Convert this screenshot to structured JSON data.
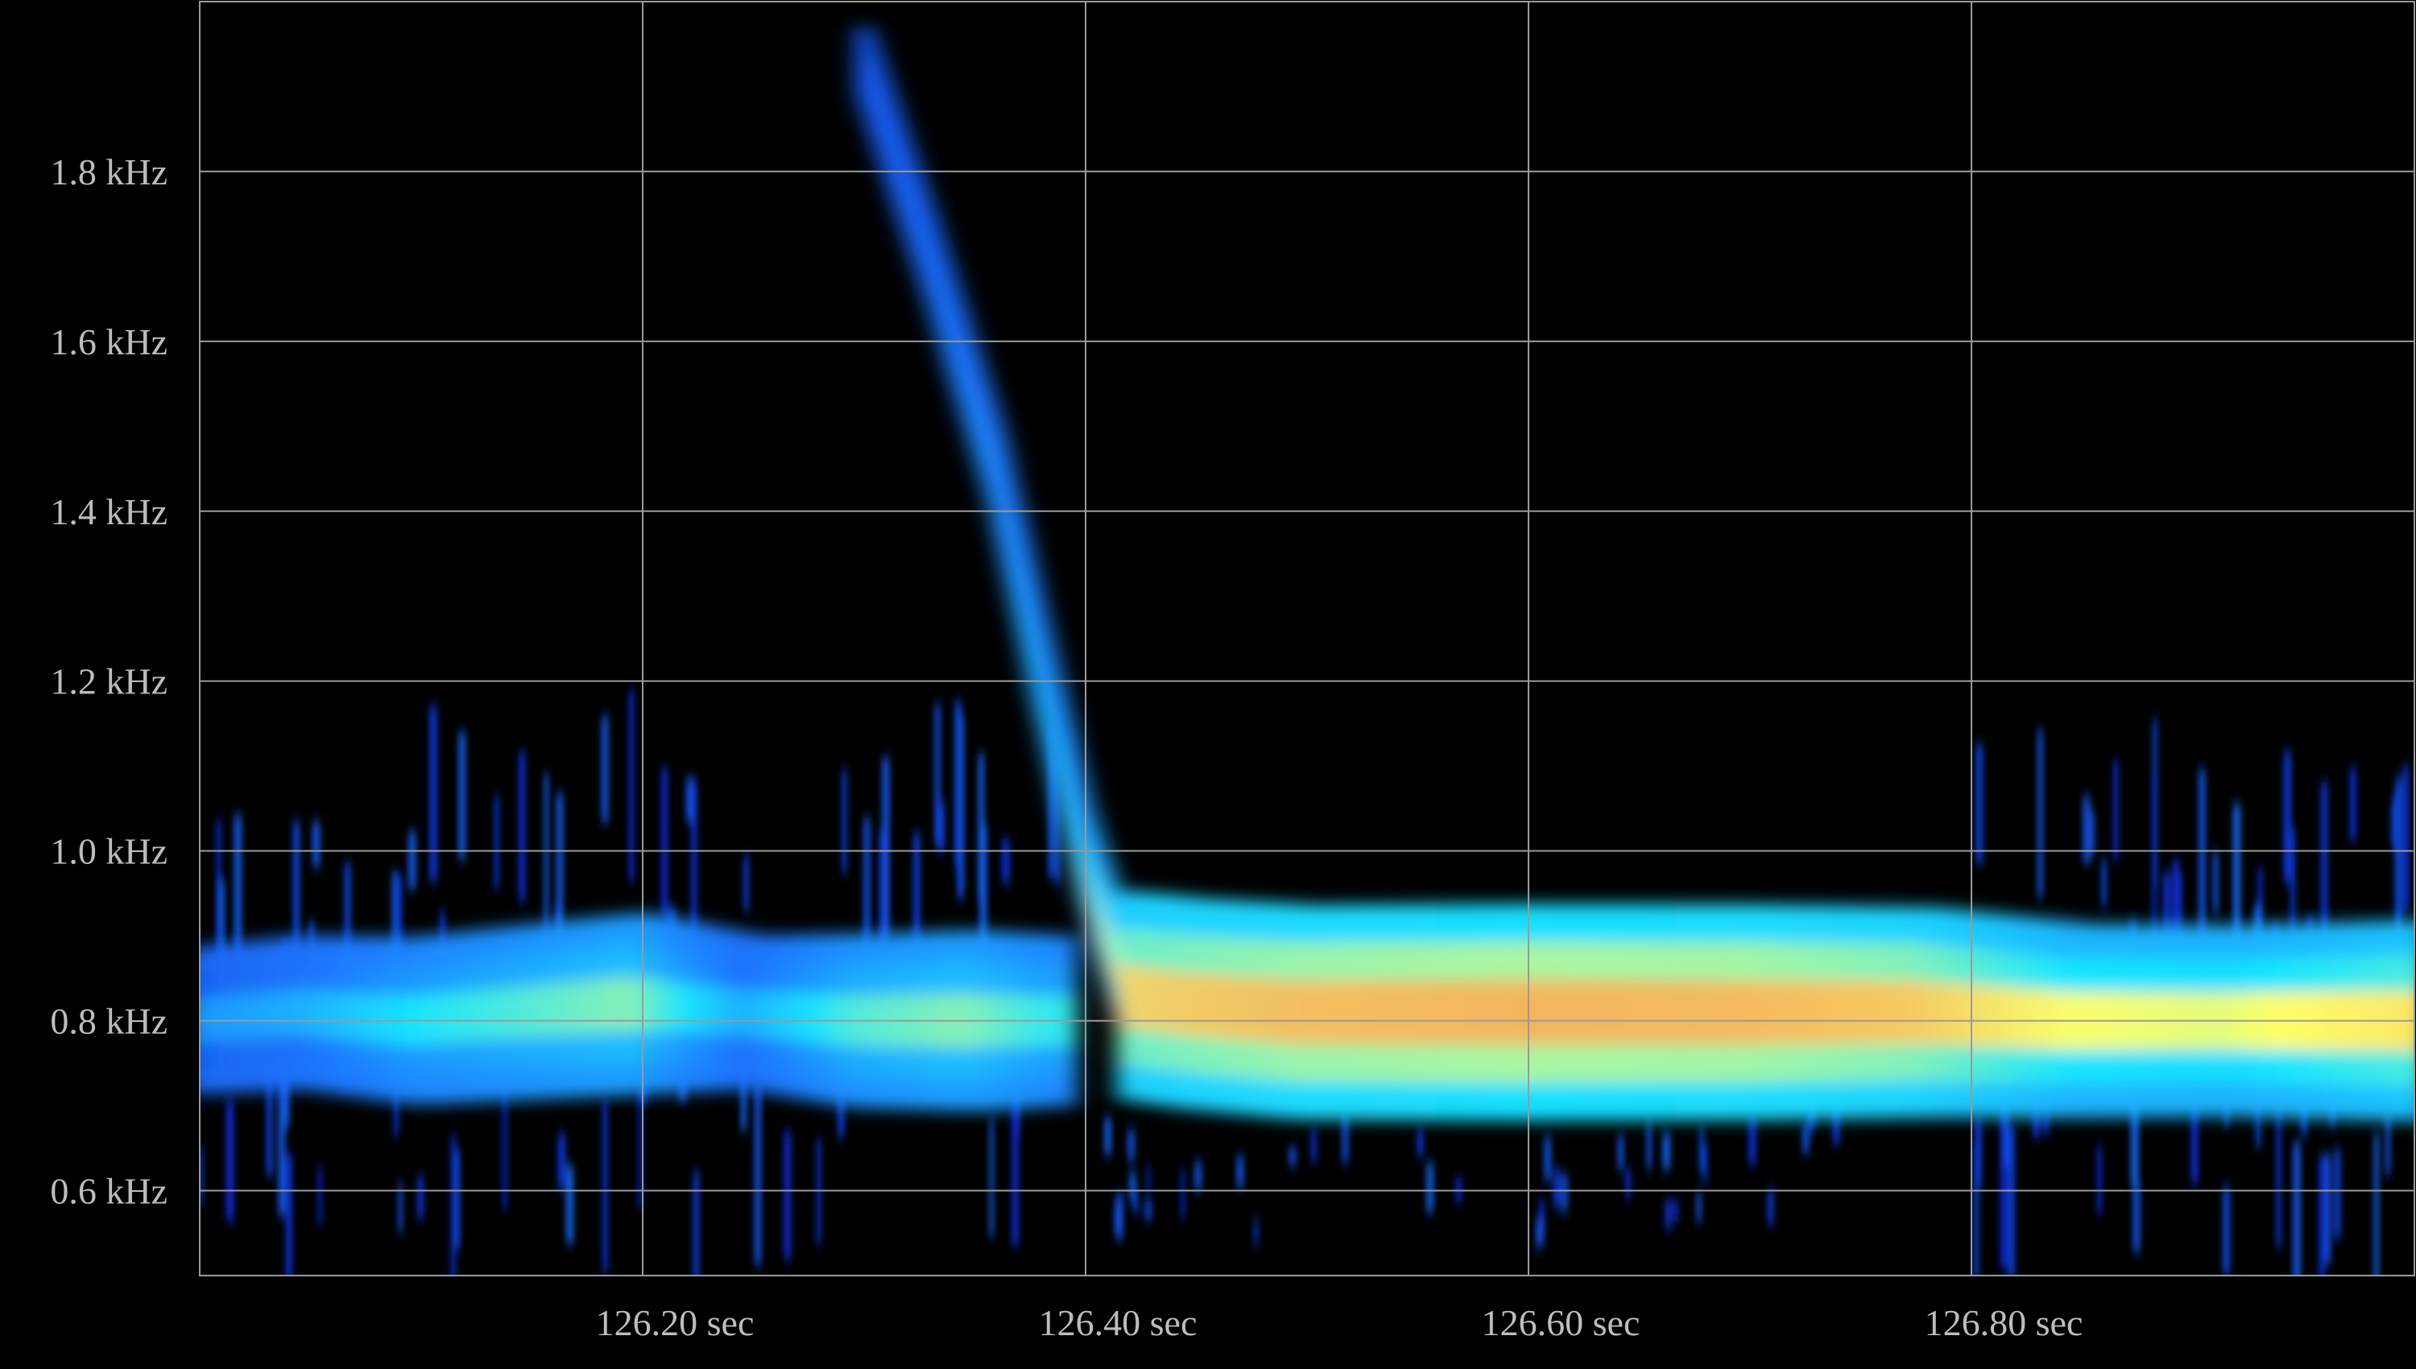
{
  "chart_data": {
    "type": "heatmap",
    "subtype": "spectrogram",
    "title": "",
    "xlabel": "",
    "ylabel": "",
    "xlim": [
      126.0,
      127.0
    ],
    "ylim": [
      0.5,
      2.0
    ],
    "x_ticks": [
      {
        "value": 126.2,
        "label": "126.20 sec"
      },
      {
        "value": 126.4,
        "label": "126.40 sec"
      },
      {
        "value": 126.6,
        "label": "126.60 sec"
      },
      {
        "value": 126.8,
        "label": "126.80 sec"
      }
    ],
    "y_ticks": [
      {
        "value": 0.6,
        "label": "0.6 kHz"
      },
      {
        "value": 0.8,
        "label": "0.8 kHz"
      },
      {
        "value": 1.0,
        "label": "1.0 kHz"
      },
      {
        "value": 1.2,
        "label": "1.2 kHz"
      },
      {
        "value": 1.4,
        "label": "1.4 kHz"
      },
      {
        "value": 1.6,
        "label": "1.6 kHz"
      },
      {
        "value": 1.8,
        "label": "1.8 kHz"
      }
    ],
    "grid": true,
    "colormap": [
      "#000000",
      "#0a2bd6",
      "#1f7cff",
      "#19e6ff",
      "#ffff6a",
      "#f2a85a"
    ],
    "background_color": "#000000",
    "series": [
      {
        "x": [
          126.3,
          126.33,
          126.36,
          126.38,
          126.4,
          126.42,
          126.45,
          126.5
        ],
        "y": [
          1.93,
          1.7,
          1.45,
          1.22,
          1.0,
          0.83,
          0.82,
          0.81
        ],
        "intensity": [
          0.35,
          0.4,
          0.5,
          0.58,
          0.65,
          0.9,
          0.92,
          0.95
        ]
      },
      {
        "x": [
          126.5,
          126.6,
          126.7,
          126.78,
          126.85,
          126.92,
          127.0
        ],
        "y": [
          0.81,
          0.81,
          0.81,
          0.81,
          0.8,
          0.8,
          0.8
        ],
        "intensity": [
          0.95,
          0.97,
          0.96,
          0.92,
          0.8,
          0.78,
          0.85
        ]
      },
      {
        "x": [
          126.0,
          126.05,
          126.1,
          126.15,
          126.2,
          126.25,
          126.3,
          126.35,
          126.39
        ],
        "y": [
          0.8,
          0.81,
          0.8,
          0.81,
          0.82,
          0.81,
          0.8,
          0.8,
          0.8
        ],
        "intensity": [
          0.45,
          0.5,
          0.6,
          0.65,
          0.7,
          0.5,
          0.65,
          0.7,
          0.62
        ]
      }
    ]
  }
}
